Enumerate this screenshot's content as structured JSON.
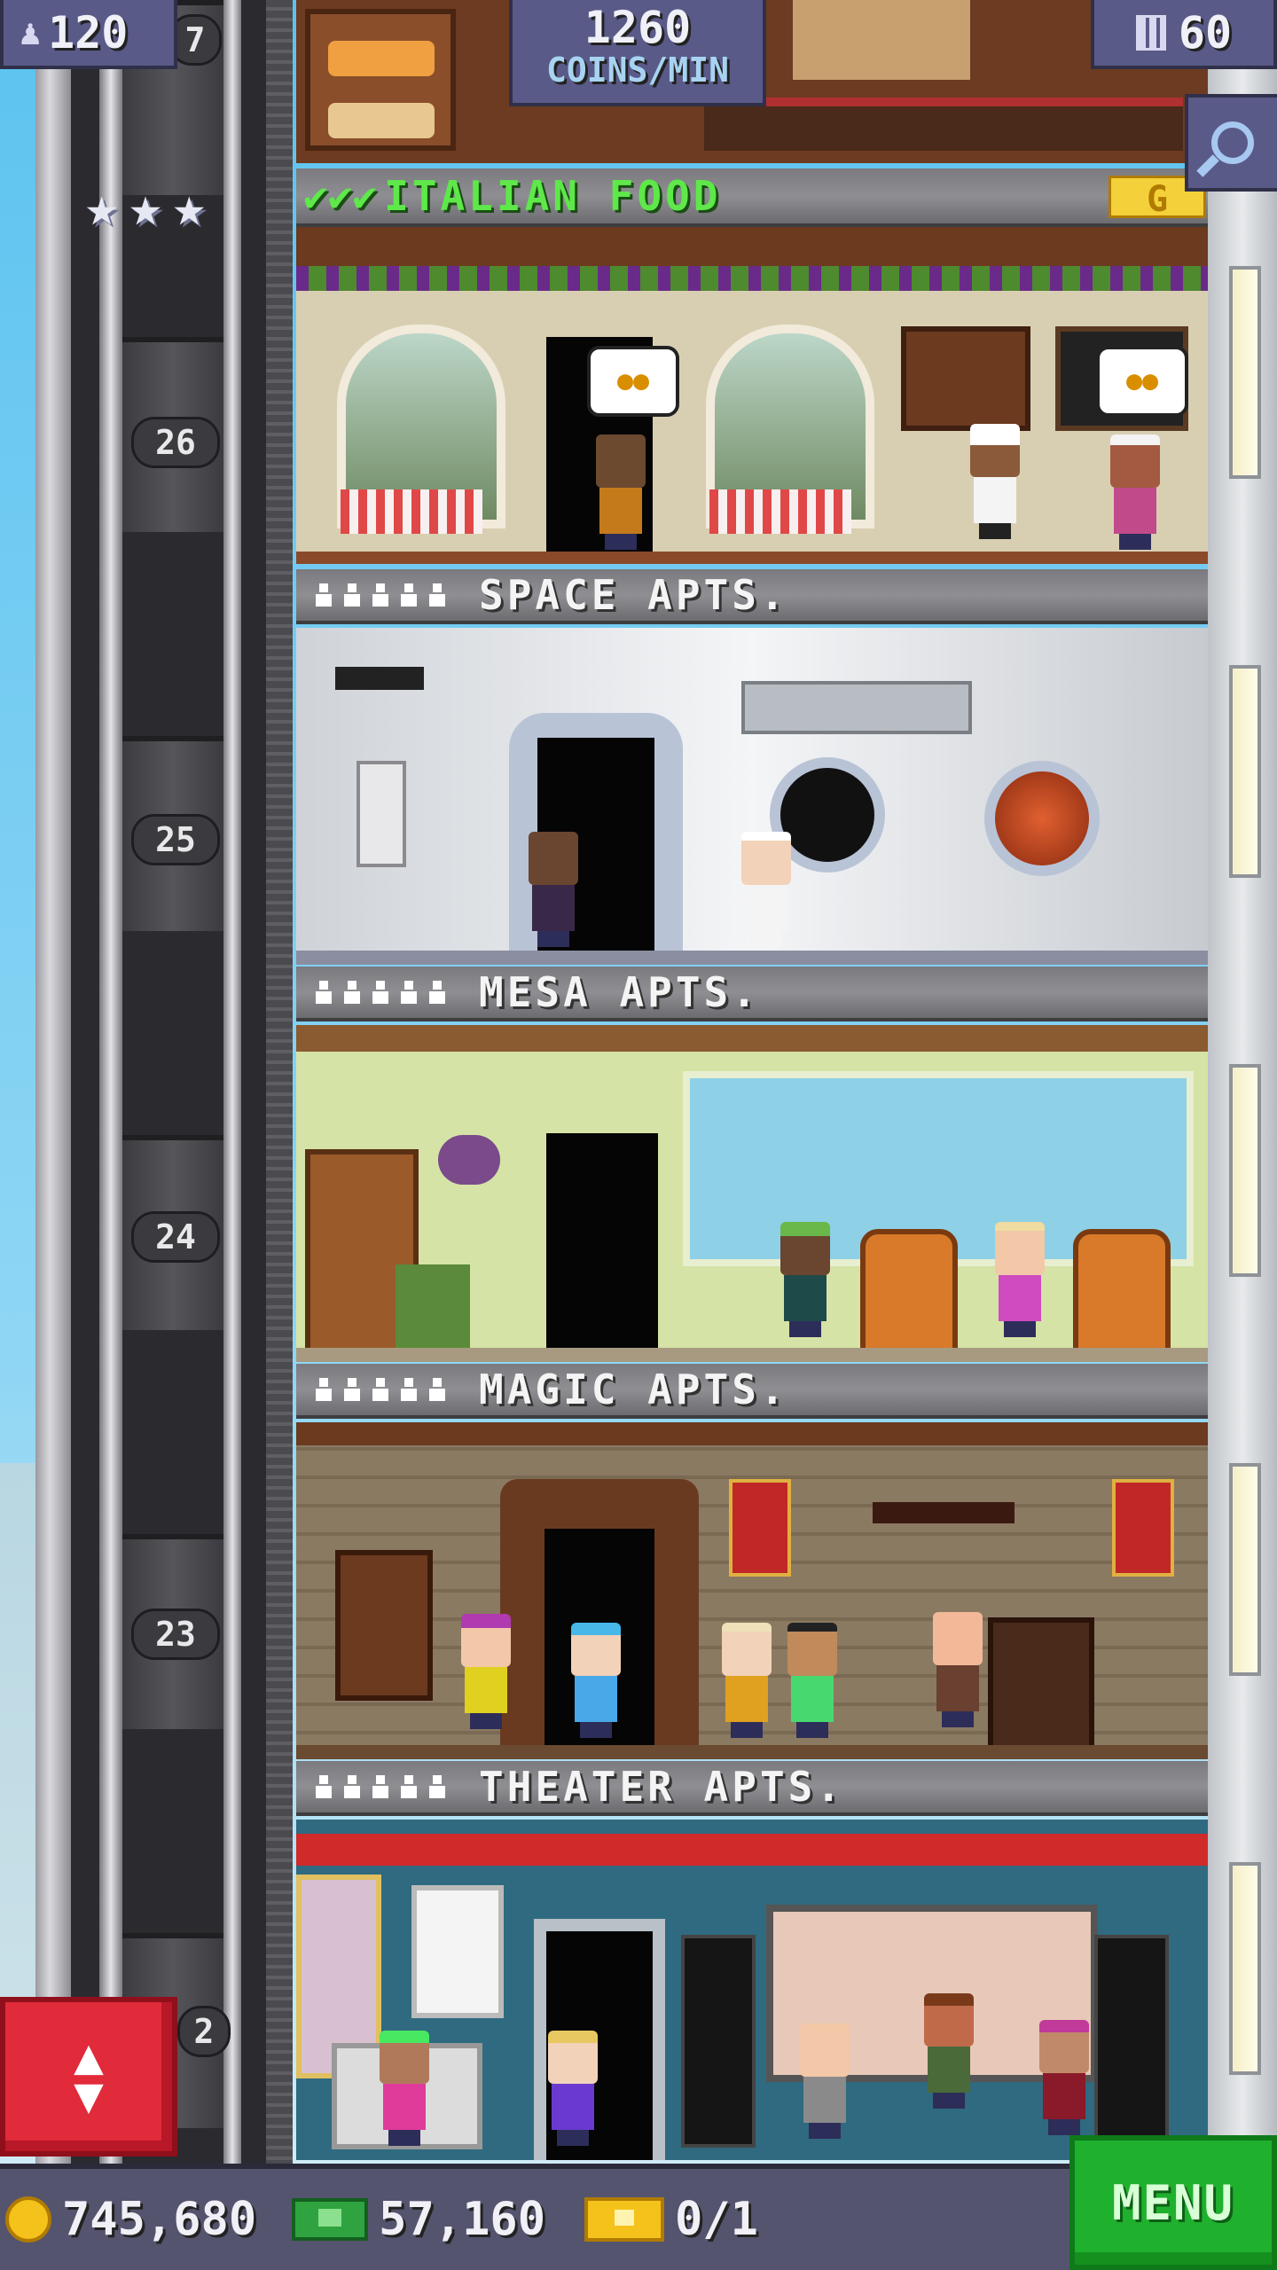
{
  "hud": {
    "population": "120",
    "coins_per_min_value": "1260",
    "coins_per_min_unit": "COINS/MIN",
    "floor_count": "60"
  },
  "floors": {
    "top_number_partial": "7",
    "italian_food": {
      "label": "ITALIAN FOOD",
      "checks": "✔✔✔",
      "tag": "G",
      "number": "26"
    },
    "space_apts": {
      "label": "SPACE APTS.",
      "number": "25"
    },
    "mesa_apts": {
      "label": "MESA APTS.",
      "number": "24"
    },
    "magic_apts": {
      "label": "MAGIC APTS.",
      "number": "23"
    },
    "theater_apts": {
      "label": "THEATER APTS.",
      "number": "2"
    }
  },
  "stars": [
    "★",
    "★",
    "★"
  ],
  "bottom_bar": {
    "coins": "745,680",
    "bux": "57,160",
    "tickets": "0/1",
    "menu_label": "MENU"
  },
  "icons": {
    "population": "person-icon",
    "floors": "building-icon",
    "search": "search-icon",
    "elevator": "elevator-updown-icon",
    "coin": "coin-icon",
    "bux": "bux-icon",
    "ticket": "ticket-icon"
  },
  "colors": {
    "hud_panel": "#5a5a88",
    "menu_green": "#1fb02e",
    "elevator_red": "#e12a3a",
    "label_green": "#5ee84a"
  }
}
